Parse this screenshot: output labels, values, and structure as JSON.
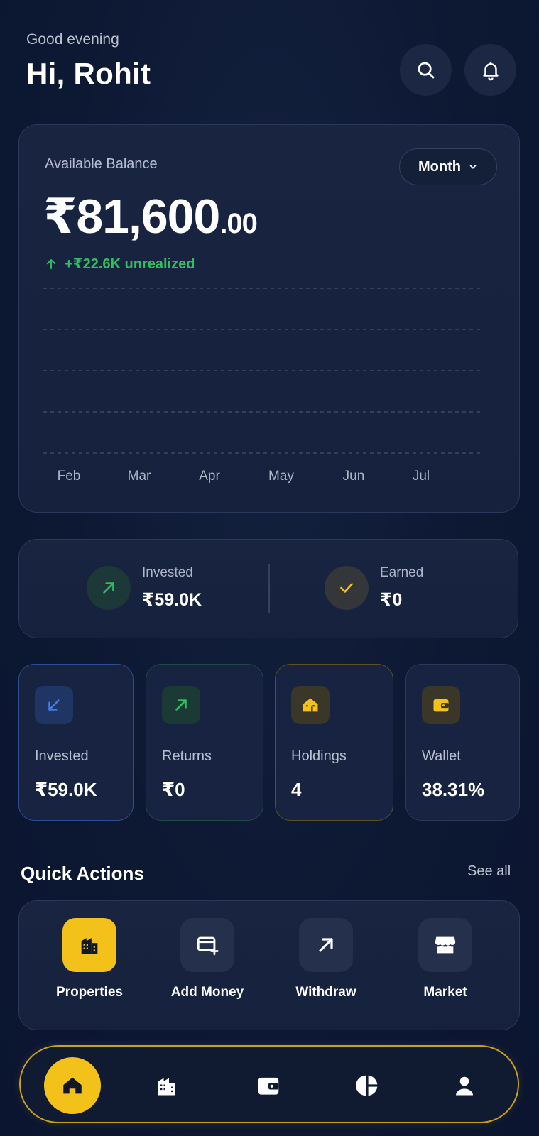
{
  "header": {
    "greeting": "Good evening",
    "title": "Hi, Rohit"
  },
  "top_actions": {
    "search_icon": "search-icon",
    "notification_icon": "bell-icon"
  },
  "balance_card": {
    "label": "Available Balance",
    "period": "Month",
    "amount_main": "₹81,600",
    "amount_decimal": ".00",
    "unrealized": "+₹22.6K unrealized"
  },
  "chart_data": {
    "type": "line",
    "categories": [
      "Feb",
      "Mar",
      "Apr",
      "May",
      "Jun",
      "Jul"
    ],
    "series": [],
    "grid": true
  },
  "summary": {
    "invested": {
      "label": "Invested",
      "value": "₹59.0K"
    },
    "earned": {
      "label": "Earned",
      "value": "₹0"
    }
  },
  "stats": [
    {
      "label": "Invested",
      "value": "₹59.0K",
      "icon": "arrow-down-left-icon",
      "color": "#3f7be6"
    },
    {
      "label": "Returns",
      "value": "₹0",
      "icon": "arrow-up-right-icon",
      "color": "#2fbd62"
    },
    {
      "label": "Holdings",
      "value": "4",
      "icon": "home-icon",
      "color": "#f2c21b"
    },
    {
      "label": "Wallet",
      "value": "38.31%",
      "icon": "wallet-icon",
      "color": "#f2c21b"
    }
  ],
  "quick_actions": {
    "title": "Quick Actions",
    "see_all": "See all",
    "items": [
      {
        "label": "Properties",
        "icon": "building-icon"
      },
      {
        "label": "Add Money",
        "icon": "add-card-icon"
      },
      {
        "label": "Withdraw",
        "icon": "arrow-up-right-icon"
      },
      {
        "label": "Market",
        "icon": "store-icon"
      }
    ]
  },
  "bottom_nav": [
    "home-icon",
    "building-icon",
    "wallet-icon",
    "pie-chart-icon",
    "user-icon"
  ],
  "colors": {
    "accent": "#f2c21b",
    "positive": "#2fbd62",
    "blue": "#3f7be6",
    "background": "#0d1833",
    "card": "#172340"
  }
}
